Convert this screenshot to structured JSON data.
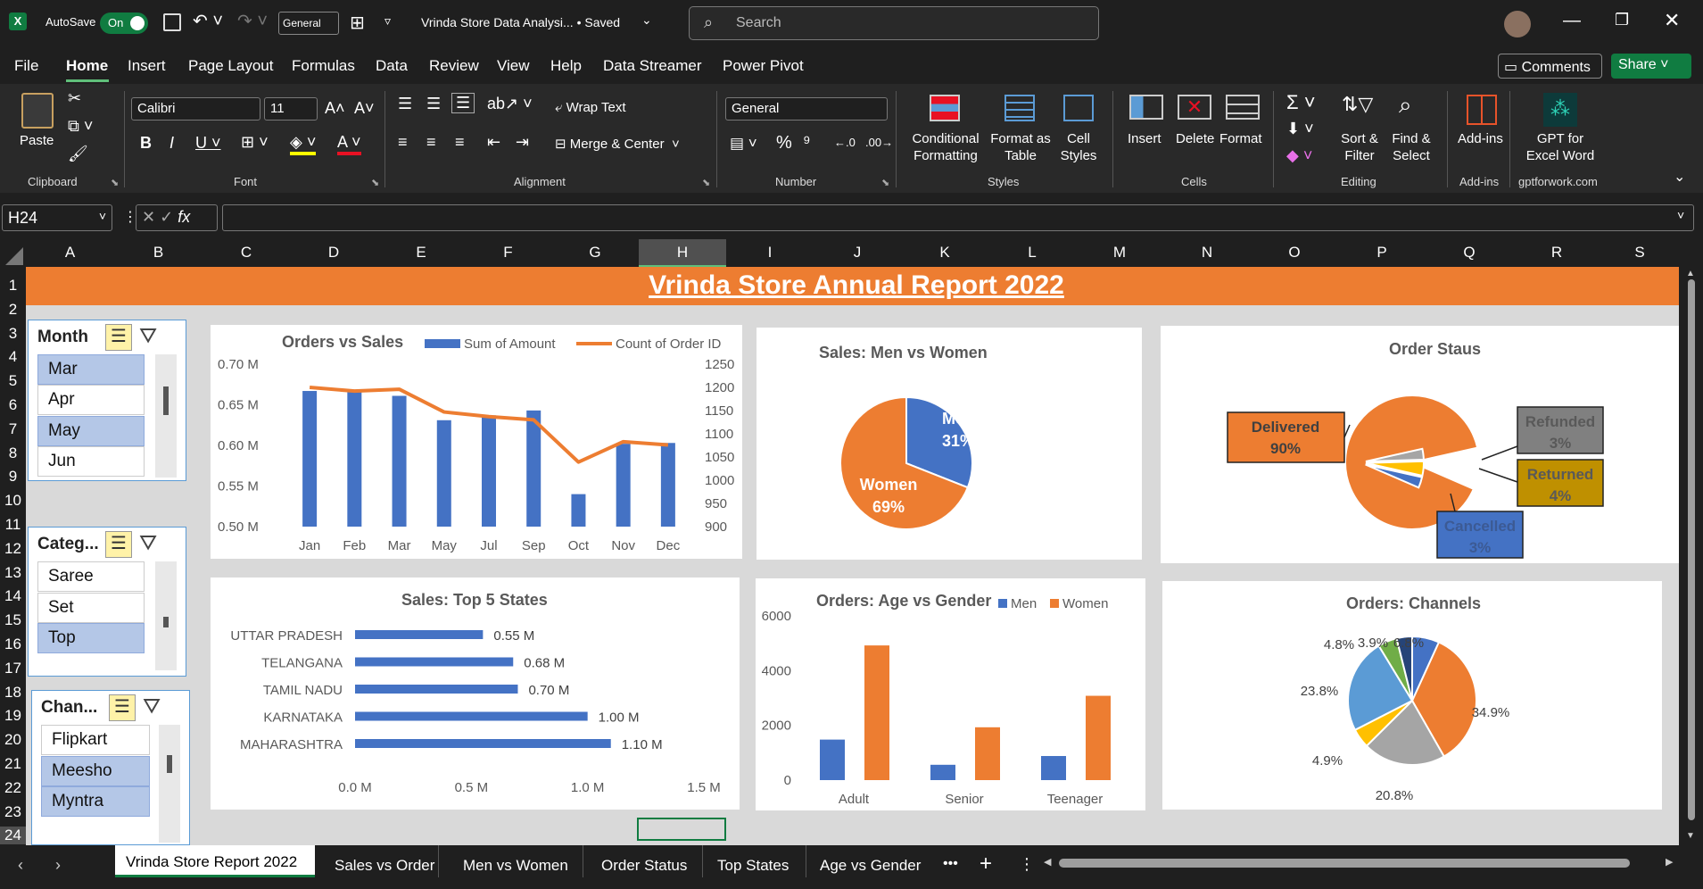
{
  "titlebar": {
    "autosave_label": "AutoSave",
    "toggle_label": "On",
    "font_box": "General",
    "doc_title": "Vrinda Store Data Analysi...  •  Saved",
    "search_placeholder": "Search"
  },
  "menu": [
    "File",
    "Home",
    "Insert",
    "Page Layout",
    "Formulas",
    "Data",
    "Review",
    "View",
    "Help",
    "Data Streamer",
    "Power Pivot"
  ],
  "menu_right": {
    "comments": "Comments",
    "share": "Share"
  },
  "ribbon": {
    "paste": "Paste",
    "clipboard": "Clipboard",
    "font_name": "Calibri",
    "font_size": "11",
    "font": "Font",
    "wrap_text": "Wrap Text",
    "merge_center": "Merge & Center",
    "alignment": "Alignment",
    "number_format": "General",
    "number": "Number",
    "conditional_formatting": "Conditional Formatting",
    "format_as_table": "Format as Table",
    "cell_styles": "Cell Styles",
    "styles": "Styles",
    "insert": "Insert",
    "delete": "Delete",
    "format": "Format",
    "cells": "Cells",
    "sort_filter": "Sort & Filter",
    "find_select": "Find & Select",
    "editing": "Editing",
    "addins": "Add-ins",
    "addins_group": "Add-ins",
    "gpt": "GPT for Excel Word",
    "gpt_group": "gptforwork.com"
  },
  "formula": {
    "namebox": "H24",
    "content": ""
  },
  "columns": [
    "A",
    "B",
    "C",
    "D",
    "E",
    "F",
    "G",
    "H",
    "I",
    "J",
    "K",
    "L",
    "M",
    "N",
    "O",
    "P",
    "Q",
    "R",
    "S"
  ],
  "rows": [
    "1",
    "2",
    "3",
    "4",
    "5",
    "6",
    "7",
    "8",
    "9",
    "10",
    "11",
    "12",
    "13",
    "14",
    "15",
    "16",
    "17",
    "18",
    "19",
    "20",
    "21",
    "22",
    "23",
    "24"
  ],
  "banner_title": "Vrinda Store Annual Report 2022",
  "slicers": [
    {
      "title": "Month",
      "items": [
        {
          "label": "Mar",
          "selected": true
        },
        {
          "label": "Apr",
          "selected": false
        },
        {
          "label": "May",
          "selected": true
        },
        {
          "label": "Jun",
          "selected": false
        }
      ]
    },
    {
      "title": "Categ...",
      "items": [
        {
          "label": "Saree",
          "selected": false
        },
        {
          "label": "Set",
          "selected": false
        },
        {
          "label": "Top",
          "selected": true
        }
      ]
    },
    {
      "title": "Chan...",
      "items": [
        {
          "label": "Flipkart",
          "selected": false
        },
        {
          "label": "Meesho",
          "selected": true
        },
        {
          "label": "Myntra",
          "selected": true
        }
      ]
    }
  ],
  "chart_data": [
    {
      "type": "bar",
      "title": "Orders vs Sales",
      "categories": [
        "Jan",
        "Feb",
        "Mar",
        "May",
        "Jul",
        "Sep",
        "Oct",
        "Nov",
        "Dec"
      ],
      "series": [
        {
          "name": "Sum of Amount",
          "kind": "bar",
          "axis": "left",
          "color": "#4472c4",
          "values": [
            0.667,
            0.667,
            0.661,
            0.631,
            0.637,
            0.643,
            0.54,
            0.602,
            0.603
          ]
        },
        {
          "name": "Count of Order ID",
          "kind": "line",
          "axis": "right",
          "color": "#ed7d31",
          "values": [
            1200,
            1192,
            1196,
            1147,
            1137,
            1130,
            1039,
            1083,
            1076
          ]
        }
      ],
      "yleft": {
        "ticks": [
          "0.70 M",
          "0.65 M",
          "0.60 M",
          "0.55 M",
          "0.50 M"
        ],
        "range": [
          0.5,
          0.7
        ]
      },
      "yright": {
        "ticks": [
          "1250",
          "1200",
          "1150",
          "1100",
          "1050",
          "1000",
          "950",
          "900"
        ],
        "range": [
          900,
          1250
        ]
      }
    },
    {
      "type": "pie",
      "title": "Sales: Men vs Women",
      "slices": [
        {
          "label": "Men",
          "pct": "31%",
          "value": 31,
          "color": "#4472c4"
        },
        {
          "label": "Women",
          "pct": "69%",
          "value": 69,
          "color": "#ed7d31"
        }
      ]
    },
    {
      "type": "pie",
      "title": "Order Staus",
      "slices": [
        {
          "label": "Delivered",
          "pct": "90%",
          "value": 90,
          "color": "#ed7d31"
        },
        {
          "label": "Refunded",
          "pct": "3%",
          "value": 3,
          "color": "#a5a5a5"
        },
        {
          "label": "Returned",
          "pct": "4%",
          "value": 4,
          "color": "#ffc000"
        },
        {
          "label": "Cancelled",
          "pct": "3%",
          "value": 3,
          "color": "#4472c4"
        }
      ]
    },
    {
      "type": "bar",
      "orientation": "horizontal",
      "title": "Sales: Top 5 States",
      "categories": [
        "UTTAR PRADESH",
        "TELANGANA",
        "TAMIL NADU",
        "KARNATAKA",
        "MAHARASHTRA"
      ],
      "values": [
        0.55,
        0.68,
        0.7,
        1.0,
        1.1
      ],
      "value_labels": [
        "0.55 M",
        "0.68 M",
        "0.70 M",
        "1.00 M",
        "1.10 M"
      ],
      "xticks": [
        "0.0 M",
        "0.5 M",
        "1.0 M",
        "1.5 M"
      ],
      "xlim": [
        0,
        1.5
      ],
      "color": "#4472c4"
    },
    {
      "type": "bar",
      "title": "Orders: Age vs Gender",
      "categories": [
        "Adult",
        "Senior",
        "Teenager"
      ],
      "series": [
        {
          "name": "Men",
          "color": "#4472c4",
          "values": [
            1480,
            560,
            880
          ]
        },
        {
          "name": "Women",
          "color": "#ed7d31",
          "values": [
            4920,
            1930,
            3080
          ]
        }
      ],
      "yticks": [
        "6000",
        "4000",
        "2000",
        "0"
      ],
      "ylim": [
        0,
        6000
      ]
    },
    {
      "type": "pie",
      "title": "Orders: Channels",
      "slices": [
        {
          "pct": "34.9%",
          "value": 34.9,
          "color": "#ed7d31"
        },
        {
          "pct": "20.8%",
          "value": 20.8,
          "color": "#a5a5a5"
        },
        {
          "pct": "4.9%",
          "value": 4.9,
          "color": "#ffc000"
        },
        {
          "pct": "23.8%",
          "value": 23.8,
          "color": "#5b9bd5"
        },
        {
          "pct": "4.8%",
          "value": 4.8,
          "color": "#70ad47"
        },
        {
          "pct": "3.9%",
          "value": 3.9,
          "color": "#264478"
        },
        {
          "pct": "6.8%",
          "value": 6.8,
          "color": "#4472c4"
        }
      ]
    }
  ],
  "tabs": [
    "Vrinda Store Report 2022",
    "Sales vs Order",
    "Men vs Women",
    "Order Status",
    "Top States",
    "Age vs Gender"
  ],
  "colors": {
    "accent": "#107c41",
    "banner": "#ed7d31",
    "sheet_bg": "#d9d9d9"
  }
}
